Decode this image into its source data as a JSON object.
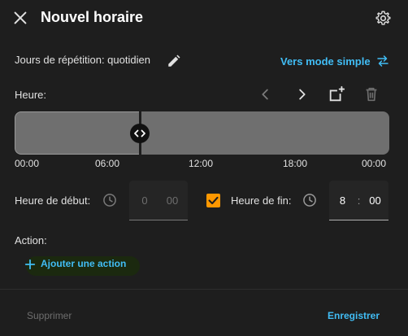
{
  "dialog": {
    "title": "Nouvel horaire"
  },
  "repeat": {
    "label": "Jours de répétition: quotidien",
    "simple_mode_label": "Vers mode simple"
  },
  "hour": {
    "label": "Heure:"
  },
  "timeline": {
    "ticks": [
      "00:00",
      "06:00",
      "12:00",
      "18:00",
      "00:00"
    ],
    "segment_end_fraction": 0.335
  },
  "start": {
    "label": "Heure de début:",
    "hours": "0",
    "minutes": "00"
  },
  "end": {
    "enabled": true,
    "label": "Heure de fin:",
    "hours": "8",
    "separator": ":",
    "minutes": "00"
  },
  "action": {
    "label": "Action:",
    "add_label": "Ajouter une action"
  },
  "footer": {
    "delete_label": "Supprimer",
    "save_label": "Enregistrer"
  },
  "colors": {
    "background": "#1e1e1e",
    "accent": "#41bdf5",
    "checkbox": "#ff9800",
    "timeline_fill": "#6f6f6f"
  }
}
